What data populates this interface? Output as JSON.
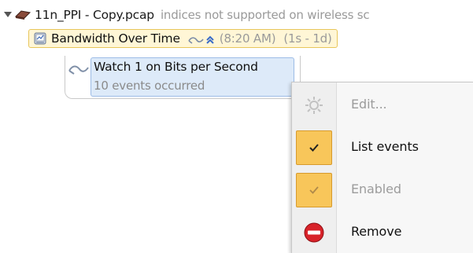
{
  "tree": {
    "file": {
      "name": "11n_PPI - Copy.pcap",
      "note": "indices not supported on wireless sc"
    },
    "node": {
      "title": "Bandwidth Over Time",
      "time": "(8:20 AM)",
      "range": "(1s - 1d)"
    },
    "watch": {
      "title": "Watch 1 on Bits per Second",
      "subtitle": "10 events occurred"
    }
  },
  "context_menu": {
    "items": [
      {
        "label": "Edit...",
        "icon": "gear-icon",
        "state": "disabled"
      },
      {
        "label": "List events",
        "icon": "check-icon",
        "state": "checked"
      },
      {
        "label": "Enabled",
        "icon": "check-icon",
        "state": "checked-disabled"
      },
      {
        "label": "Remove",
        "icon": "remove-icon",
        "state": "enabled"
      }
    ]
  },
  "colors": {
    "highlight_bg": "#fff6d6",
    "highlight_border": "#e8c65a",
    "selection_bg": "#ddeaf9",
    "selection_border": "#9dbce6",
    "checked_bg": "#f8c65a",
    "remove_red": "#d8232a",
    "muted_text": "#9a9a9a"
  }
}
